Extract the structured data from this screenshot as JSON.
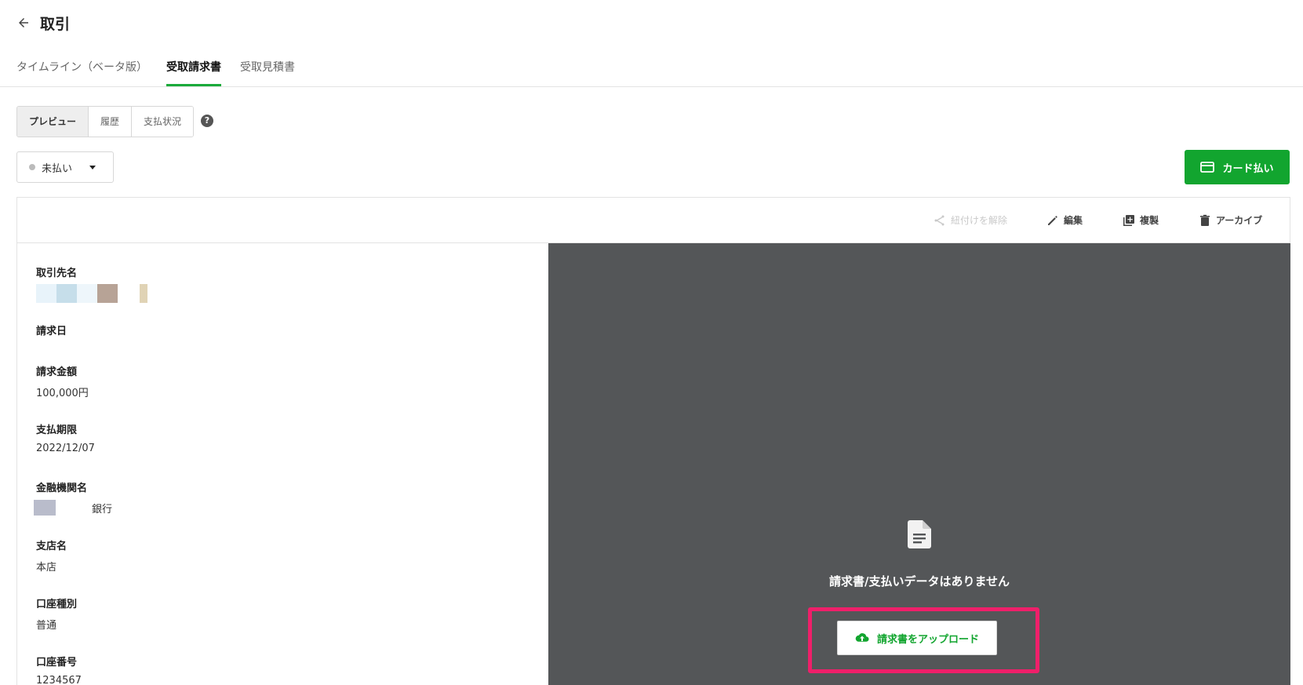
{
  "header": {
    "title": "取引"
  },
  "tabs": [
    {
      "label": "タイムライン（ベータ版）"
    },
    {
      "label": "受取請求書"
    },
    {
      "label": "受取見積書"
    }
  ],
  "segmented": [
    {
      "label": "プレビュー"
    },
    {
      "label": "履歴"
    },
    {
      "label": "支払状況"
    }
  ],
  "help_label": "?",
  "status": {
    "label": "未払い"
  },
  "card_pay": {
    "label": "カード払い"
  },
  "toolbar": {
    "unlink": "紐付けを解除",
    "edit": "編集",
    "duplicate": "複製",
    "archive": "アーカイブ"
  },
  "details": {
    "partner_label": "取引先名",
    "invoice_date_label": "請求日",
    "invoice_date_value": "",
    "amount_label": "請求金額",
    "amount_value": "100,000円",
    "due_label": "支払期限",
    "due_value": "2022/12/07",
    "bank_label": "金融機関名",
    "bank_suffix": "銀行",
    "branch_label": "支店名",
    "branch_value": "本店",
    "account_type_label": "口座種別",
    "account_type_value": "普通",
    "account_no_label": "口座番号",
    "account_no_value": "1234567"
  },
  "preview": {
    "empty_message": "請求書/支払いデータはありません",
    "upload_label": "請求書をアップロード"
  },
  "colors": {
    "accent_green": "#12a52f",
    "preview_bg": "#545658",
    "highlight_pink": "#ef1f6a"
  }
}
